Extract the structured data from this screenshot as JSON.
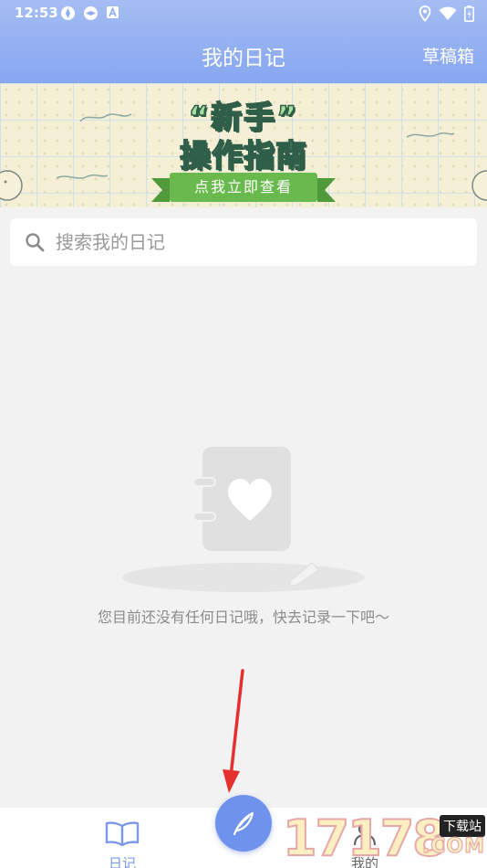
{
  "status_bar": {
    "time": "12:53"
  },
  "header": {
    "title": "我的日记",
    "drafts_label": "草稿箱"
  },
  "banner": {
    "line1": "“新手”",
    "line2": "操作指南",
    "cta": "点我立即查看"
  },
  "search": {
    "placeholder": "搜索我的日记"
  },
  "empty_state": {
    "message": "您目前还没有任何日记哦，快去记录一下吧～"
  },
  "bottom_nav": {
    "diary_label": "日记",
    "mine_label": "我的"
  },
  "watermark": {
    "number": "17178",
    "tag": "下载站",
    "suffix": ".COM"
  },
  "colors": {
    "header_gradient_top": "#a5bdf3",
    "header_gradient_bottom": "#86a6f0",
    "accent": "#6f93ec",
    "background": "#f2f2f2"
  }
}
